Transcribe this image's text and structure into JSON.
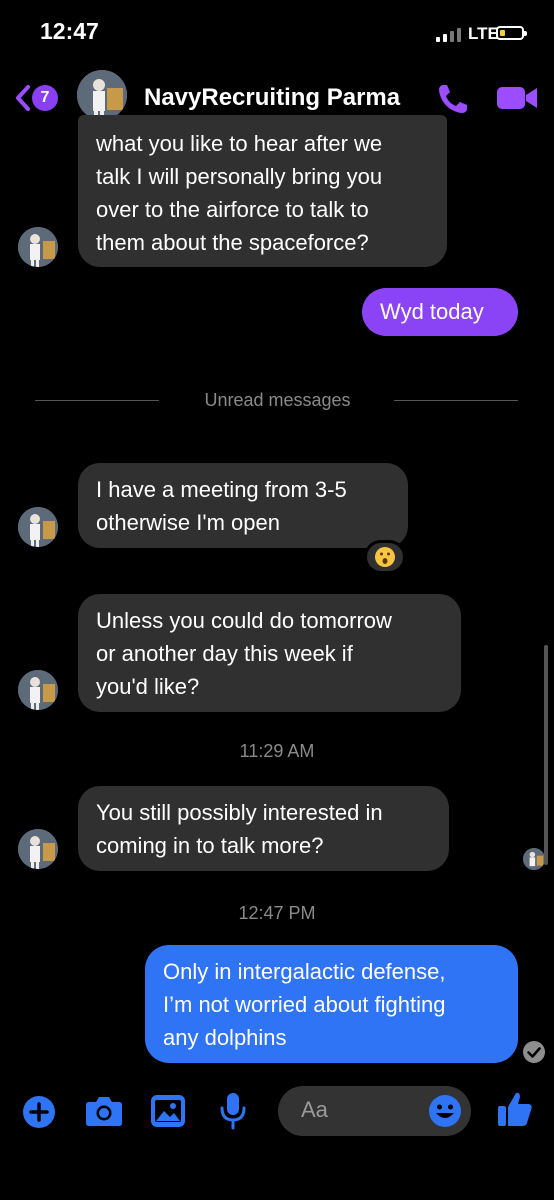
{
  "status_bar": {
    "time": "12:47",
    "network": "LTE"
  },
  "header": {
    "unread_count": "7",
    "contact_name": "NavyRecruiting Parma"
  },
  "messages": [
    {
      "lines": [
        "what you like to hear after we",
        "talk I will personally bring you",
        "over to the airforce to talk to",
        "them about the spaceforce?"
      ]
    },
    {
      "text": "Wyd today"
    },
    {
      "lines": [
        "I have a meeting from 3-5",
        "otherwise I'm open"
      ],
      "reaction": "😮"
    },
    {
      "lines": [
        "Unless you could do tomorrow",
        "or another day this week if",
        "you'd like?"
      ]
    },
    {
      "lines": [
        "You still possibly interested in",
        "coming in to talk more?"
      ]
    },
    {
      "lines": [
        "Only in intergalactic defense,",
        "I’m not worried about fighting",
        "any dolphins"
      ]
    }
  ],
  "separators": {
    "unread": "Unread messages",
    "time1": "11:29 AM",
    "time2": "12:47 PM"
  },
  "composer": {
    "placeholder": "Aa"
  },
  "colors": {
    "accent": "#9b4dff",
    "blue": "#2f74f5",
    "incoming": "#303030"
  }
}
